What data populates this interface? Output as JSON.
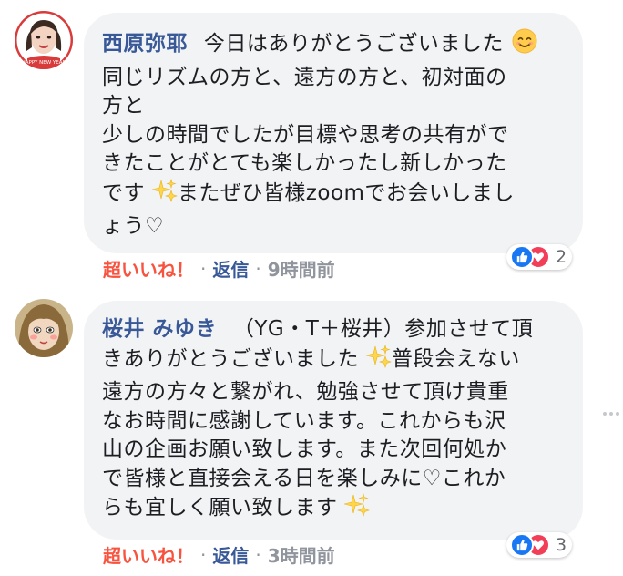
{
  "comments": [
    {
      "author": "西原弥耶",
      "avatar_badge": "HAPPY NEW YEAR",
      "lines": [
        "今日はありがとうございました",
        "同じリズムの方と、遠方の方と、初対面の",
        "方と",
        "少しの時間でしたが目標や思考の共有がで",
        "きたことがとても楽しかったし新しかった",
        "です",
        "またぜひ皆様zoomでお会いしまし",
        "ょう♡"
      ],
      "super_like_label": "超いいね！",
      "reply_label": "返信",
      "time": "9時間前",
      "reaction_count": "2",
      "reactions": [
        "like-icon",
        "love-icon"
      ]
    },
    {
      "author": "桜井 みゆき",
      "lines": [
        "（YG・T＋桜井）参加させて頂",
        "きありがとうございました",
        "普段会えない",
        "遠方の方々と繋がれ、勉強させて頂け貴重",
        "なお時間に感謝しています。これからも沢",
        "山の企画お願い致します。また次回何処か",
        "で皆様と直接会える日を楽しみに♡これか",
        "らも宜しく願い致します"
      ],
      "super_like_label": "超いいね！",
      "reply_label": "返信",
      "time": "3時間前",
      "reaction_count": "3",
      "reactions": [
        "like-icon",
        "love-icon"
      ]
    }
  ],
  "separator": "·",
  "colors": {
    "author": "#385898",
    "super_like": "#f7533f",
    "meta": "#90949c",
    "bubble": "#f2f3f5",
    "like": "#1877f2",
    "love": "#f33e58"
  }
}
